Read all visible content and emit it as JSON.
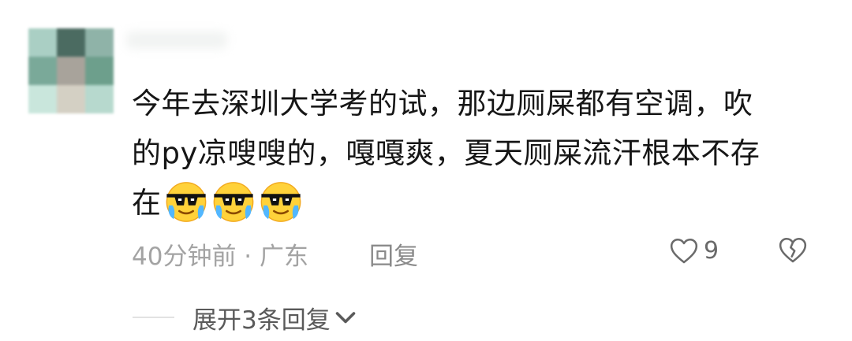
{
  "comment": {
    "avatar_colors": [
      "#aacfc4",
      "#4b6b61",
      "#8fb3a8",
      "#7aa999",
      "#a8a39b",
      "#6d9f8c",
      "#c9e6dc",
      "#d4d0c4",
      "#b7d9ce"
    ],
    "text_line1": "今年去深圳大学考的试，那边厕屎都有空调，吹",
    "text_line2": "的py凉嗖嗖的，嘎嘎爽，夏天厕屎流汗根本不存",
    "text_line3": "在",
    "emojis": [
      "cool-crying-emoji-icon",
      "cool-crying-emoji-icon",
      "cool-crying-emoji-icon"
    ],
    "meta": "40分钟前 · 广东",
    "reply_label": "回复",
    "like_count": "9"
  },
  "replies": {
    "expand_label": "展开3条回复"
  }
}
